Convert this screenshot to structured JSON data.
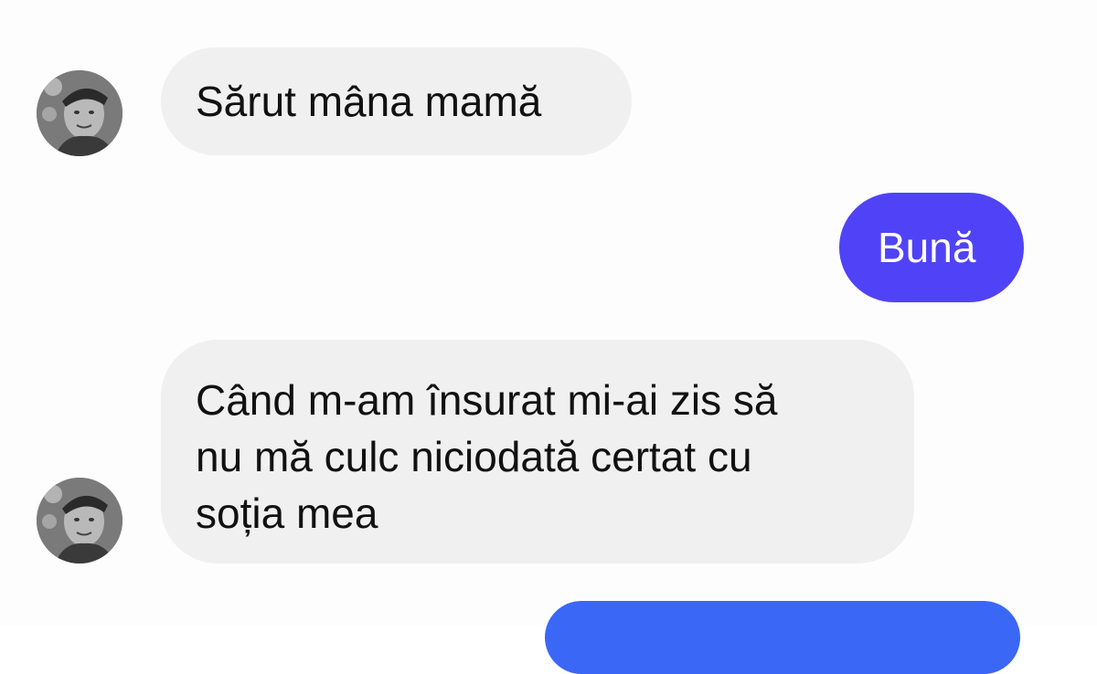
{
  "conversation": {
    "messages": [
      {
        "side": "incoming",
        "text": "Sărut mâna mamă"
      },
      {
        "side": "outgoing",
        "text": "Bună"
      },
      {
        "side": "incoming",
        "text": "Când m-am însurat mi-ai zis să\nnu mă culc niciodată certat cu\nsoția mea"
      },
      {
        "side": "outgoing",
        "text": ""
      }
    ]
  },
  "colors": {
    "incoming_bubble": "#f0f0f0",
    "outgoing_bubble": "#5043f7",
    "outgoing_bubble_partial": "#3b67f6",
    "text_dark": "#111111",
    "text_light": "#ffffff"
  },
  "icons": [
    "contact-avatar-icon"
  ]
}
